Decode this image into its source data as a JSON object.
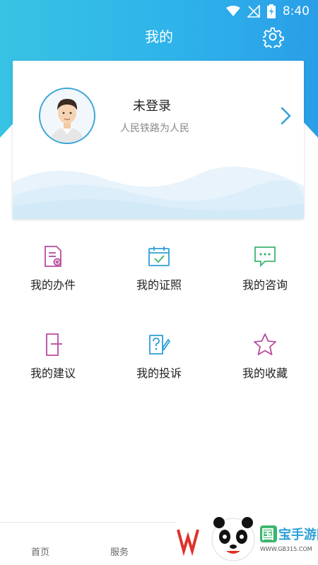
{
  "status_bar": {
    "time": "8:40"
  },
  "header": {
    "title": "我的"
  },
  "profile": {
    "name": "未登录",
    "motto": "人民铁路为人民"
  },
  "menu": [
    {
      "label": "我的办件",
      "icon": "document-icon",
      "color": "#b84b9e"
    },
    {
      "label": "我的证照",
      "icon": "calendar-check-icon",
      "color": "#2c9fd6"
    },
    {
      "label": "我的咨询",
      "icon": "chat-bubble-icon",
      "color": "#3bb56f"
    },
    {
      "label": "我的建议",
      "icon": "door-icon",
      "color": "#b84b9e"
    },
    {
      "label": "我的投诉",
      "icon": "question-pencil-icon",
      "color": "#2c9fd6"
    },
    {
      "label": "我的收藏",
      "icon": "star-icon",
      "color": "#b84b9e"
    }
  ],
  "tabs": [
    {
      "label": "首页"
    },
    {
      "label": "服务"
    }
  ],
  "watermark": {
    "text": "国宝手游网",
    "url": "WWW.GB315.COM"
  },
  "colors": {
    "accent": "#2eb3ea",
    "purple": "#b84b9e",
    "blue": "#2c9fd6",
    "green": "#3bb56f"
  }
}
